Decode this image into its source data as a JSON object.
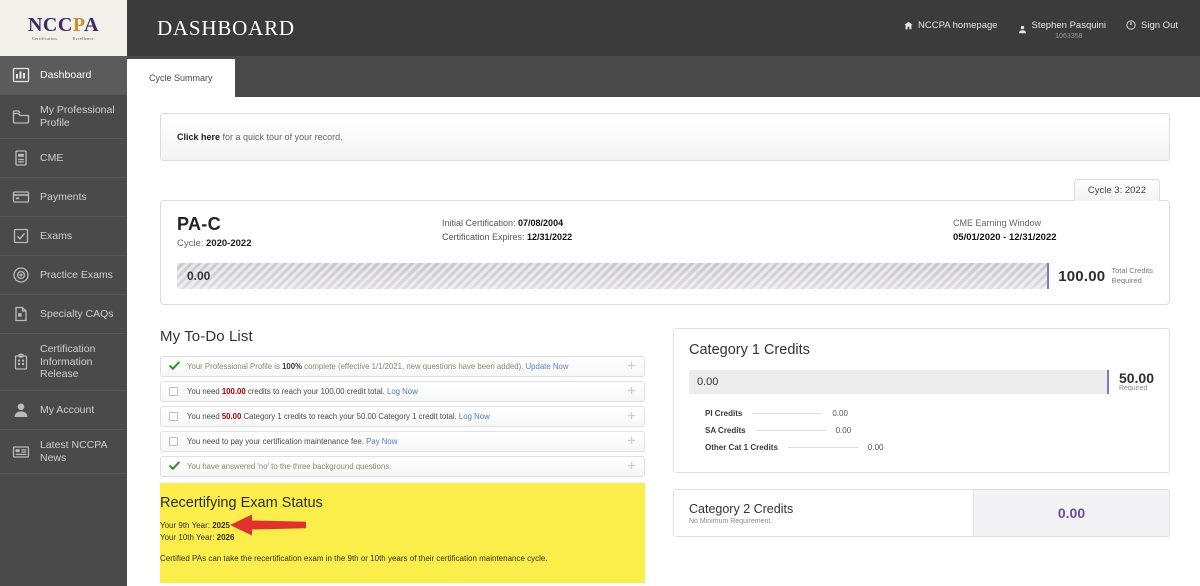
{
  "brand": {
    "logo_main_1": "NCC",
    "logo_main_2": "P",
    "logo_main_3": "A",
    "logo_sub_left": "Certification.",
    "logo_sub_right": "Excellence."
  },
  "header": {
    "title": "DASHBOARD",
    "homepage_link": "NCCPA homepage",
    "user_name": "Stephen Pasquini",
    "user_id": "1063358",
    "sign_out": "Sign Out"
  },
  "tabs": [
    {
      "label": "Cycle Summary",
      "active": true
    }
  ],
  "sidebar": {
    "items": [
      {
        "label": "Dashboard",
        "icon": "bar-chart-icon",
        "active": true
      },
      {
        "label": "My Professional Profile",
        "icon": "folder-icon",
        "active": false
      },
      {
        "label": "CME",
        "icon": "document-icon",
        "active": false
      },
      {
        "label": "Payments",
        "icon": "credit-card-icon",
        "active": false
      },
      {
        "label": "Exams",
        "icon": "checkbox-icon",
        "active": false
      },
      {
        "label": "Practice Exams",
        "icon": "target-icon",
        "active": false
      },
      {
        "label": "Specialty CAQs",
        "icon": "certificate-icon",
        "active": false
      },
      {
        "label": "Certification Information Release",
        "icon": "clipboard-icon",
        "active": false
      },
      {
        "label": "My Account",
        "icon": "user-icon",
        "active": false
      },
      {
        "label": "Latest NCCPA News",
        "icon": "news-icon",
        "active": false
      }
    ]
  },
  "notice": {
    "link_text": "Click here",
    "rest_text": " for a quick tour of your record."
  },
  "cycle": {
    "tab_label": "Cycle 3: 2022",
    "credential": "PA-C",
    "cycle_label": "Cycle: ",
    "cycle_years": "2020-2022",
    "initial_cert_label": "Initial Certification: ",
    "initial_cert_value": "07/08/2004",
    "expires_label": "Certification Expires: ",
    "expires_value": "12/31/2022",
    "window_label": "CME Earning Window",
    "window_value": "05/01/2020 - 12/31/2022",
    "earned": "0.00",
    "required": "100.00",
    "required_caption_1": "Total Credits",
    "required_caption_2": "Required",
    "progress_percent": 0
  },
  "todo": {
    "title": "My To-Do List",
    "items": [
      {
        "state": "done",
        "segments": [
          {
            "t": "Your Professional Profile is ",
            "style": "plain"
          },
          {
            "t": "100%",
            "style": "bold"
          },
          {
            "t": " complete (effective 1/1/2021, new questions have been added). ",
            "style": "plain"
          },
          {
            "t": "Update Now",
            "style": "link"
          }
        ]
      },
      {
        "state": "open",
        "segments": [
          {
            "t": "You need ",
            "style": "plain"
          },
          {
            "t": "100.00",
            "style": "red"
          },
          {
            "t": " credits to reach your 100.00 credit total. ",
            "style": "plain"
          },
          {
            "t": "Log Now",
            "style": "link"
          }
        ]
      },
      {
        "state": "open",
        "segments": [
          {
            "t": "You need ",
            "style": "plain"
          },
          {
            "t": "50.00",
            "style": "red"
          },
          {
            "t": " Category 1 credits to reach your 50.00 Category 1 credit total. ",
            "style": "plain"
          },
          {
            "t": "Log Now",
            "style": "link"
          }
        ]
      },
      {
        "state": "open",
        "segments": [
          {
            "t": "You need to pay your certification maintenance fee. ",
            "style": "plain"
          },
          {
            "t": "Pay Now",
            "style": "link"
          }
        ]
      },
      {
        "state": "done",
        "segments": [
          {
            "t": "You have answered 'no' to the three background questions.",
            "style": "plain"
          }
        ]
      }
    ]
  },
  "recert": {
    "title": "Recertifying Exam Status",
    "year9_label": "Your 9th Year: ",
    "year9_value": "2025",
    "year10_label": "Your 10th Year: ",
    "year10_value": "2026",
    "note": "Certified PAs can take the recertification exam in the 9th or 10th years of their certification maintenance cycle.",
    "highlight_color": "#fbee4a",
    "arrow_color": "#e0312e"
  },
  "category1": {
    "title": "Category 1 Credits",
    "earned": "0.00",
    "required": "50.00",
    "required_caption": "Required",
    "rows": [
      {
        "name": "PI Credits",
        "value": "0.00"
      },
      {
        "name": "SA Credits",
        "value": "0.00"
      },
      {
        "name": "Other Cat 1 Credits",
        "value": "0.00"
      }
    ]
  },
  "category2": {
    "title": "Category 2 Credits",
    "subtitle": "No Minimum Requirement.",
    "value": "0.00",
    "value_color": "#6b4f9e"
  }
}
